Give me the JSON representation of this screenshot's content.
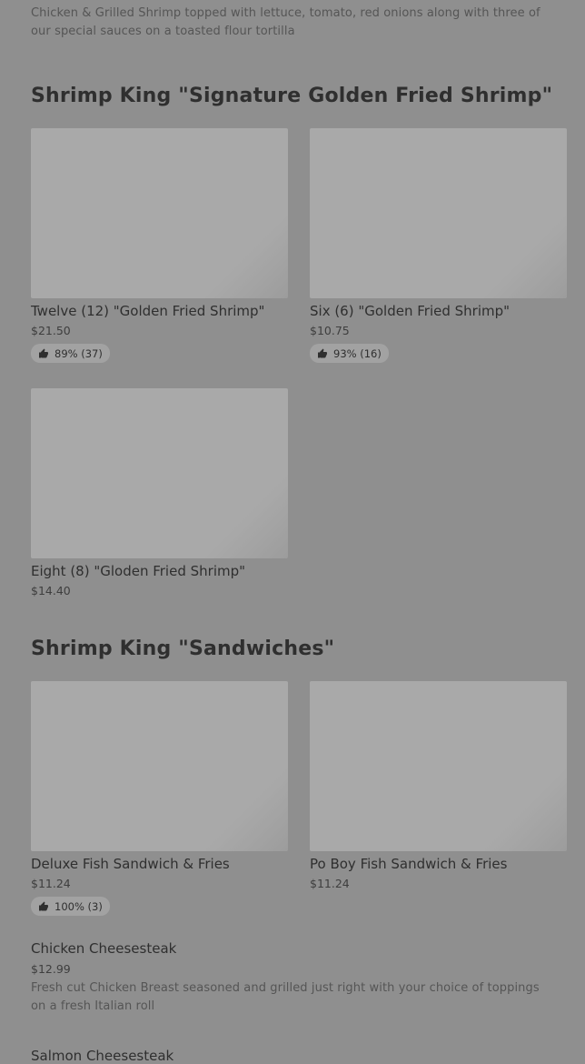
{
  "top_description": "Chicken & Grilled Shrimp topped with lettuce, tomato, red onions along with three of our special sauces on a toasted flour tortilla",
  "sections": [
    {
      "title": "Shrimp King \"Signature Golden Fried Shrimp\"",
      "cards": [
        {
          "name": "Twelve (12)  \"Golden Fried Shrimp\"",
          "price": "$21.50",
          "rating": "89% (37)"
        },
        {
          "name": "Six (6)  \"Golden Fried Shrimp\"",
          "price": "$10.75",
          "rating": "93% (16)"
        },
        {
          "name": "Eight (8)  \"Gloden Fried Shrimp\"",
          "price": "$14.40"
        }
      ]
    },
    {
      "title": "Shrimp King \"Sandwiches\"",
      "cards": [
        {
          "name": "Deluxe Fish Sandwich & Fries",
          "price": "$11.24",
          "rating": "100% (3)"
        },
        {
          "name": "Po Boy Fish Sandwich & Fries",
          "price": "$11.24"
        }
      ],
      "list_items": [
        {
          "name": "Chicken Cheesesteak",
          "price": "$12.99",
          "description": "Fresh cut Chicken Breast seasoned and grilled just right with your choice of toppings on a fresh Italian roll"
        },
        {
          "name": "Salmon Cheesesteak"
        }
      ]
    }
  ],
  "icons": {
    "rating": "thumbs-up-icon"
  }
}
